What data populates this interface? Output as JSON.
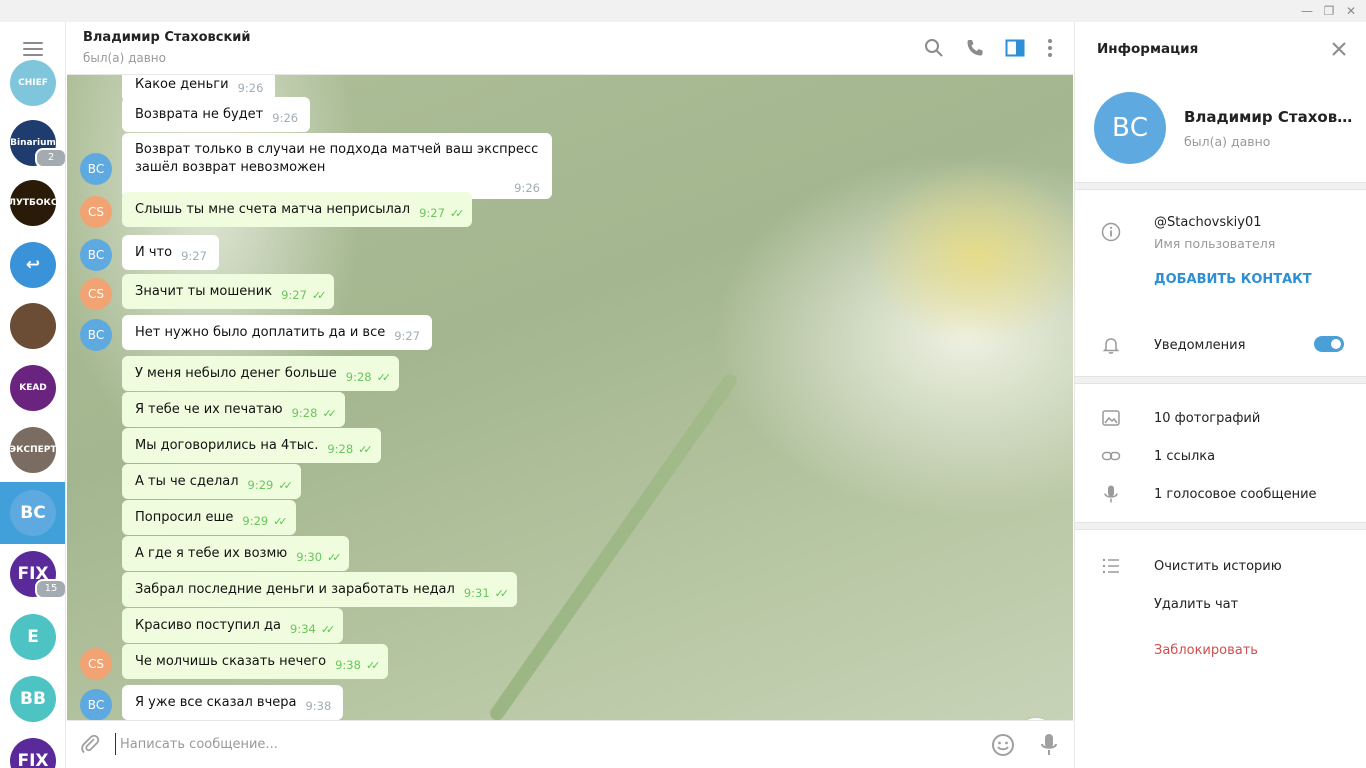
{
  "window": {
    "minimize": "—",
    "maximize": "❐",
    "close": "✕"
  },
  "rail": {
    "chats": [
      {
        "label": "CHIEF",
        "color": "#7fc6dc"
      },
      {
        "label": "Binarium",
        "color": "#1e3c6e",
        "unread": "2"
      },
      {
        "label": "ЛУТБОКС",
        "color": "#2a1a08"
      },
      {
        "label": "↩",
        "color": "#3a93d8"
      },
      {
        "label": "",
        "color": "#6b4c35"
      },
      {
        "label": "KEAD",
        "color": "#6a2480"
      },
      {
        "label": "ЭКСПЕРТ",
        "color": "#7a6c60"
      },
      {
        "label": "ВС",
        "color": "#5eaae0"
      },
      {
        "label": "FIX",
        "color": "#5b2a9a",
        "unread": "15"
      },
      {
        "label": "E",
        "color": "#4dc3c4"
      },
      {
        "label": "ВВ",
        "color": "#4dc3c4"
      },
      {
        "label": "FIX",
        "color": "#5b2a9a"
      }
    ]
  },
  "chat": {
    "name": "Владимир Стаховский",
    "status": "был(а) давно",
    "messages": [
      {
        "from": "ВС",
        "dir": "in",
        "text": "Какое деньги",
        "time": "9:26"
      },
      {
        "from": "ВС",
        "dir": "in",
        "text": "Возврата не будет",
        "time": "9:26"
      },
      {
        "from": "ВС",
        "dir": "in",
        "text": "Возврат только в случаи не подхода матчей ваш экспресс зашёл возврат невозможен",
        "time": "9:26"
      },
      {
        "from": "CS",
        "dir": "out",
        "text": "Слышь ты мне счета матча неприсылал",
        "time": "9:27"
      },
      {
        "from": "ВС",
        "dir": "in",
        "text": "И что",
        "time": "9:27"
      },
      {
        "from": "CS",
        "dir": "out",
        "text": "Значит ты мошеник",
        "time": "9:27"
      },
      {
        "from": "ВС",
        "dir": "in",
        "text": "Нет нужно было доплатить да и все",
        "time": "9:27"
      },
      {
        "from": "CS",
        "dir": "out",
        "text": "У меня небыло денег больше",
        "time": "9:28"
      },
      {
        "from": "CS",
        "dir": "out",
        "text": "Я тебе че их печатаю",
        "time": "9:28"
      },
      {
        "from": "CS",
        "dir": "out",
        "text": "Мы договорились на 4тыс.",
        "time": "9:28"
      },
      {
        "from": "CS",
        "dir": "out",
        "text": "А ты че сделал",
        "time": "9:29"
      },
      {
        "from": "CS",
        "dir": "out",
        "text": "Попросил еше",
        "time": "9:29"
      },
      {
        "from": "CS",
        "dir": "out",
        "text": "А где я тебе их возмю",
        "time": "9:30"
      },
      {
        "from": "CS",
        "dir": "out",
        "text": "Забрал последние деньги и заработать недал",
        "time": "9:31"
      },
      {
        "from": "CS",
        "dir": "out",
        "text": "Красиво поступил да",
        "time": "9:34"
      },
      {
        "from": "CS",
        "dir": "out",
        "text": "Че молчишь сказать нечего",
        "time": "9:38"
      },
      {
        "from": "ВС",
        "dir": "in",
        "text": "Я уже все сказал вчера",
        "time": "9:38"
      }
    ],
    "composer_placeholder": "Написать сообщение..."
  },
  "info": {
    "title": "Информация",
    "avatar": "ВС",
    "name": "Владимир Стахов...",
    "status": "был(а) давно",
    "username": "@Stachovskiy01",
    "username_label": "Имя пользователя",
    "add_contact": "ДОБАВИТЬ КОНТАКТ",
    "notifications": "Уведомления",
    "notifications_on": true,
    "photos": "10 фотографий",
    "links": "1 ссылка",
    "voice": "1 голосовое сообщение",
    "clear_history": "Очистить историю",
    "delete_chat": "Удалить чат",
    "block": "Заблокировать"
  },
  "colors": {
    "accent": "#419fd9",
    "out_bubble": "#effdde",
    "avatar_vs": "#5eaae0",
    "avatar_cs": "#f2a373",
    "danger": "#d14e4e"
  }
}
